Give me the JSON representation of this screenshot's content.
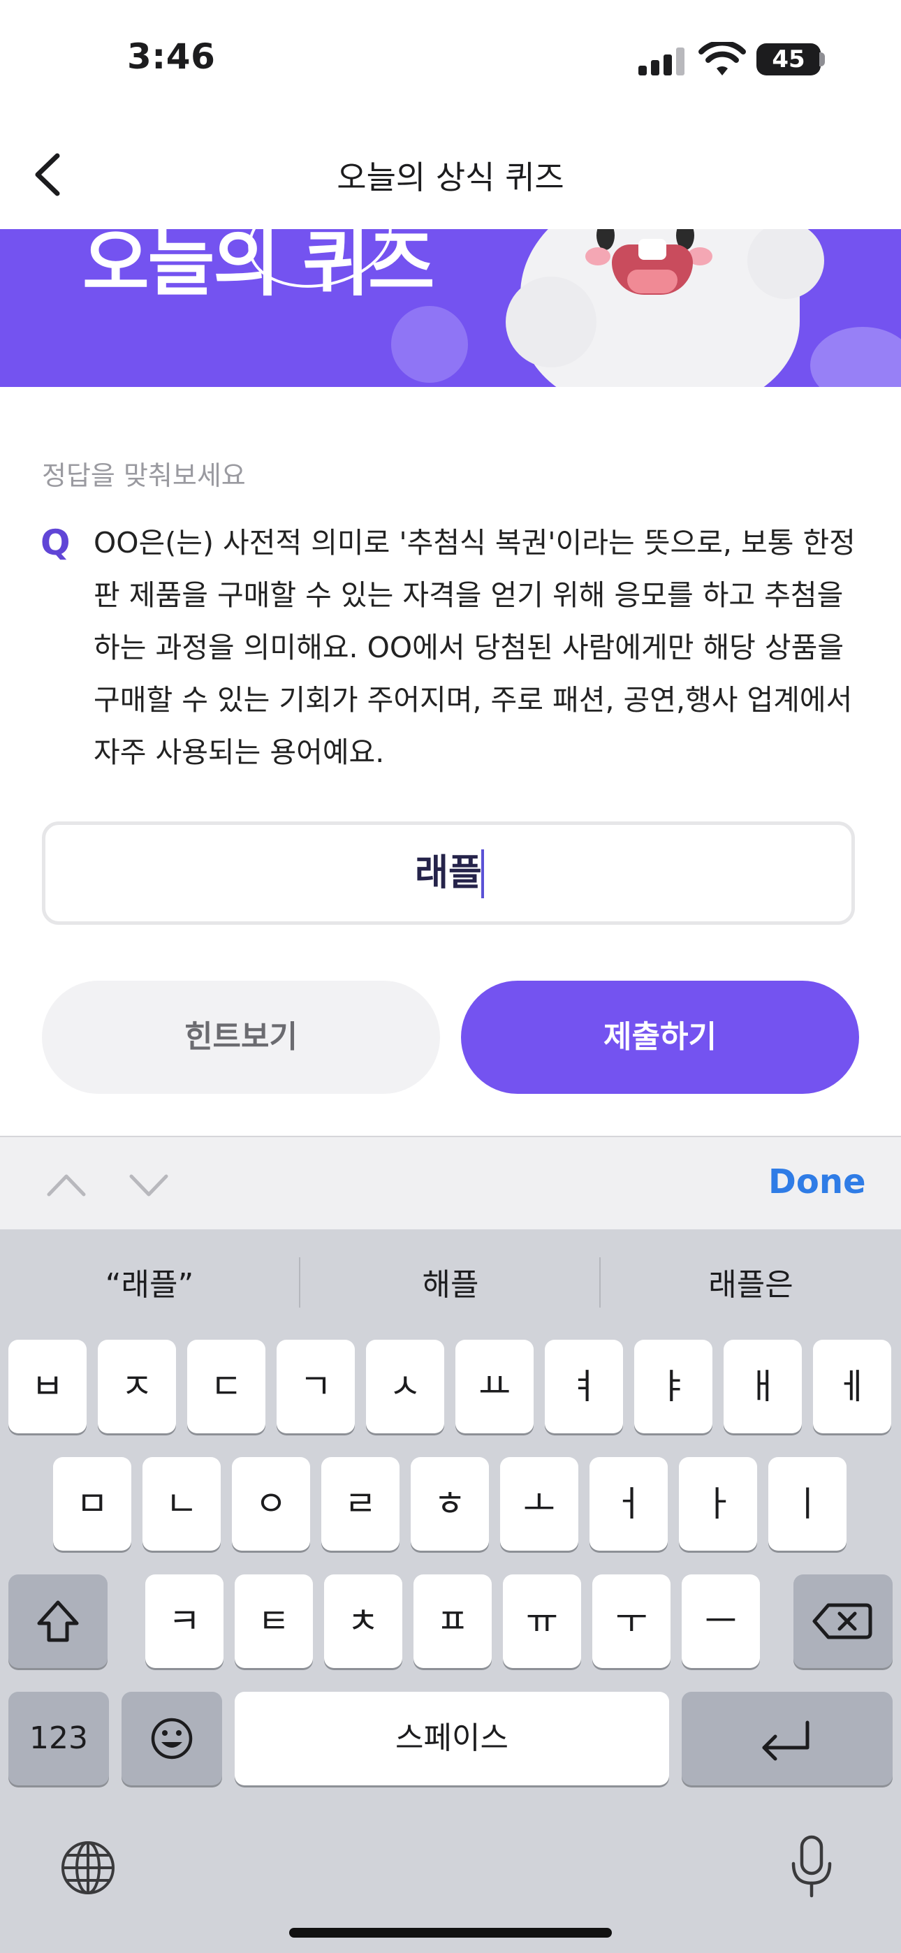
{
  "status_bar": {
    "time": "3:46",
    "battery": "45"
  },
  "nav": {
    "title": "오늘의 상식 퀴즈",
    "back_icon": "chevron-left-icon"
  },
  "banner": {
    "text": "오늘의 퀴즈",
    "accent_color": "#7453f0"
  },
  "quiz": {
    "prompt": "정답을 맞춰보세요",
    "q_mark": "Q",
    "question": "OO은(는) 사전적 의미로 '추첨식 복권'이라는 뜻으로, 보통 한정판 제품을 구매할 수 있는 자격을 얻기 위해 응모를 하고 추첨을 하는 과정을 의미해요. OO에서 당첨된 사람에게만 해당 상품을 구매할 수 있는 기회가 주어지며, 주로 패션, 공연,행사 업계에서 자주 사용되는 용어예요.",
    "answer_value": "래플"
  },
  "buttons": {
    "hint": "힌트보기",
    "submit": "제출하기"
  },
  "accessory": {
    "done": "Done"
  },
  "keyboard": {
    "suggestions": [
      "“래플”",
      "해플",
      "래플은"
    ],
    "row1": [
      "ㅂ",
      "ㅈ",
      "ㄷ",
      "ㄱ",
      "ㅅ",
      "ㅛ",
      "ㅕ",
      "ㅑ",
      "ㅐ",
      "ㅔ"
    ],
    "row2": [
      "ㅁ",
      "ㄴ",
      "ㅇ",
      "ㄹ",
      "ㅎ",
      "ㅗ",
      "ㅓ",
      "ㅏ",
      "ㅣ"
    ],
    "row3": [
      "ㅋ",
      "ㅌ",
      "ㅊ",
      "ㅍ",
      "ㅠ",
      "ㅜ",
      "ㅡ"
    ],
    "numbers": "123",
    "space": "스페이스"
  }
}
